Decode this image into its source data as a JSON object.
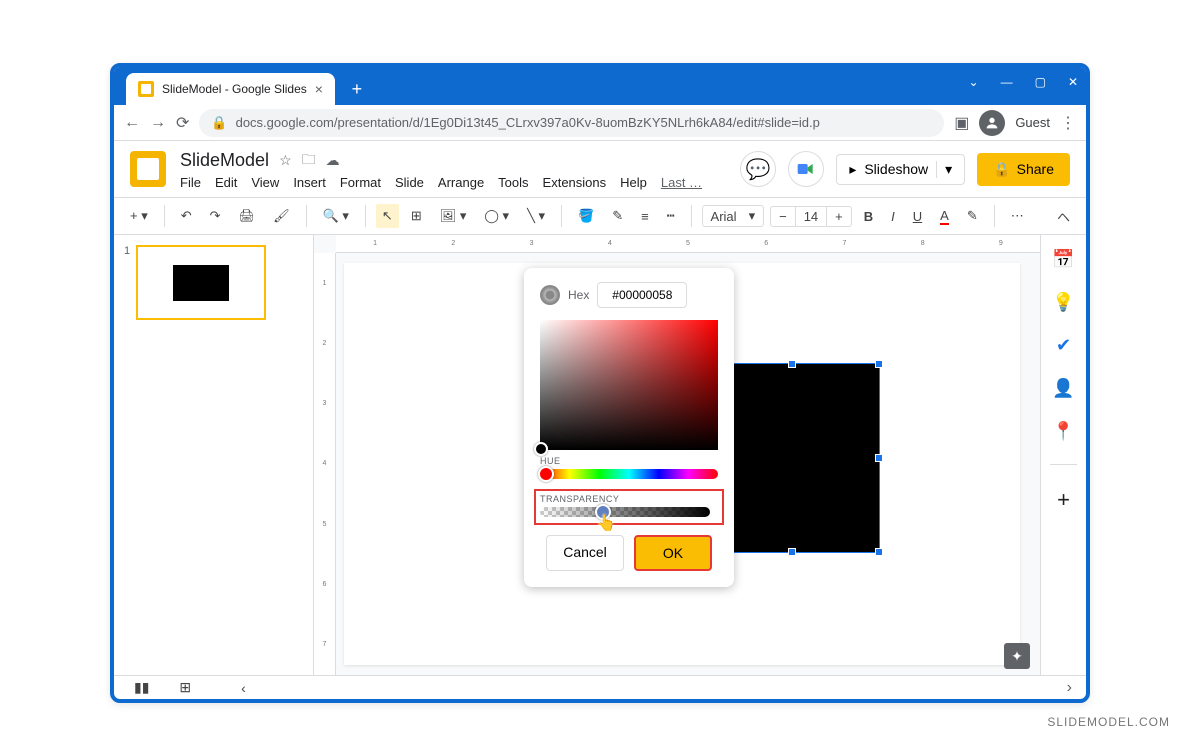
{
  "browser": {
    "tab_title": "SlideModel - Google Slides",
    "url": "docs.google.com/presentation/d/1Eg0Di13t45_CLrxv397a0Kv-8uomBzKY5NLrh6kA84/edit#slide=id.p",
    "guest_label": "Guest"
  },
  "doc": {
    "title": "SlideModel",
    "menus": [
      "File",
      "Edit",
      "View",
      "Insert",
      "Format",
      "Slide",
      "Arrange",
      "Tools",
      "Extensions",
      "Help"
    ],
    "last_label": "Last …",
    "slideshow_label": "Slideshow",
    "share_label": "Share"
  },
  "toolbar": {
    "font_name": "Arial",
    "font_size": "14"
  },
  "thumbs": {
    "slide_number": "1"
  },
  "picker": {
    "hex_label": "Hex",
    "hex_value": "#00000058",
    "hue_label": "HUE",
    "transparency_label": "TRANSPARENCY",
    "cancel": "Cancel",
    "ok": "OK"
  },
  "watermark": "SLIDEMODEL.COM"
}
